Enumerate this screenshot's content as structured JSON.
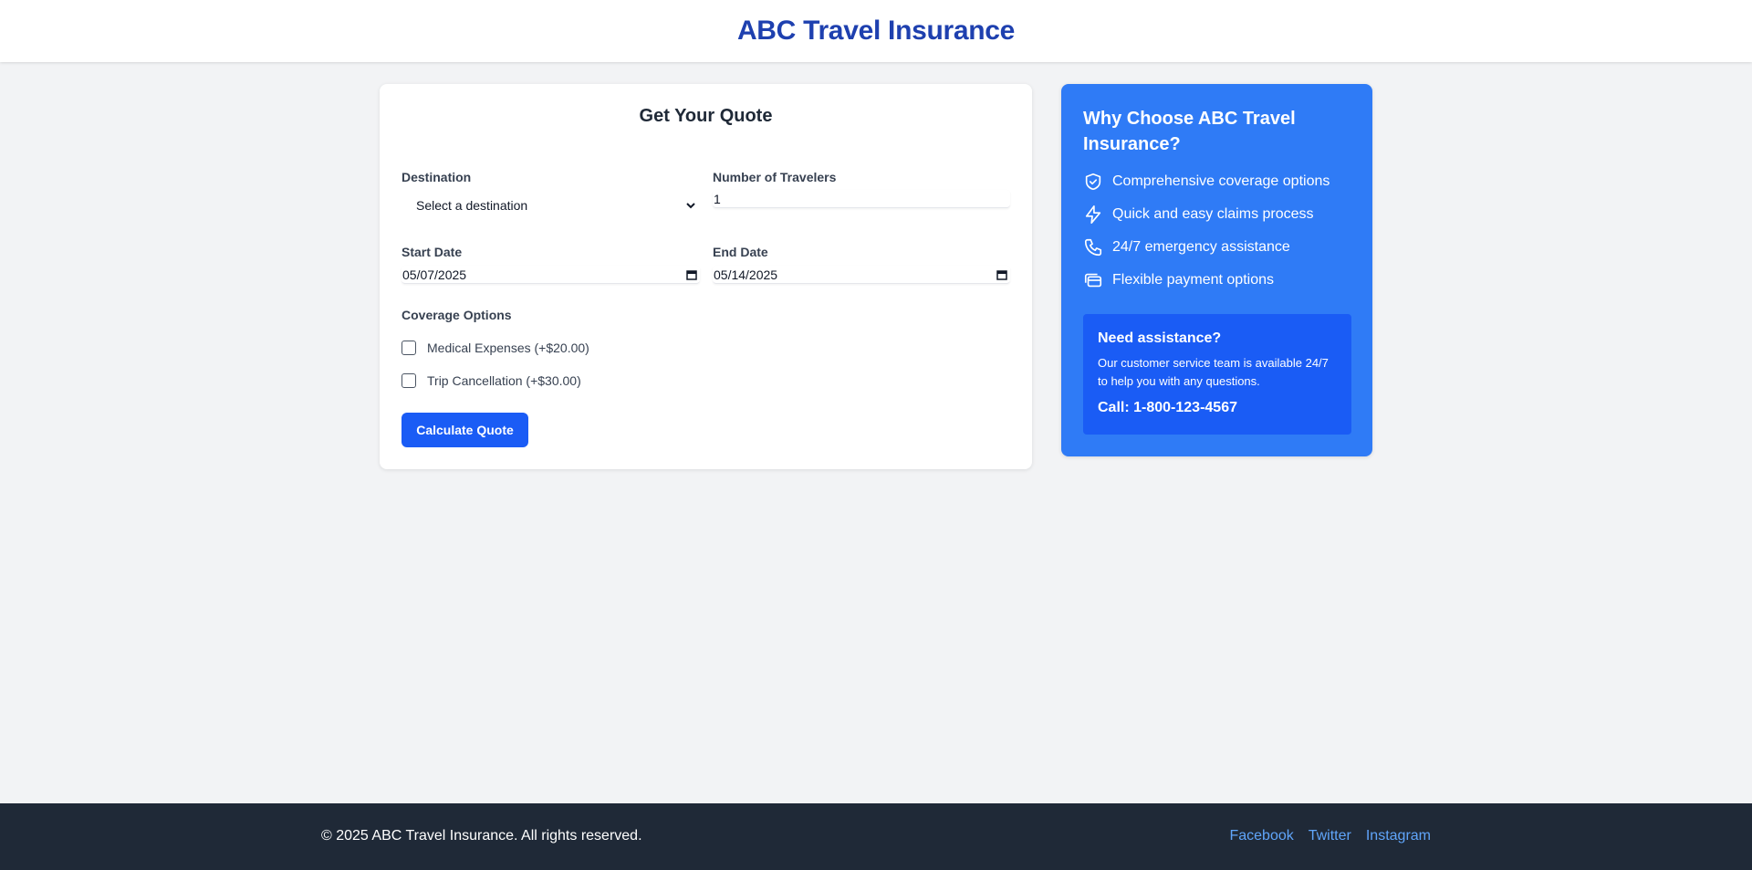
{
  "header": {
    "title": "ABC Travel Insurance"
  },
  "quote_form": {
    "title": "Get Your Quote",
    "destination_label": "Destination",
    "destination_selected": "Select a destination",
    "travelers_label": "Number of Travelers",
    "travelers_value": "1",
    "start_date_label": "Start Date",
    "start_date_value": "05/07/2025",
    "end_date_label": "End Date",
    "end_date_value": "05/14/2025",
    "coverage_label": "Coverage Options",
    "coverage_options": [
      {
        "label": "Medical Expenses (+$20.00)",
        "checked": false
      },
      {
        "label": "Trip Cancellation (+$30.00)",
        "checked": false
      }
    ],
    "calculate_label": "Calculate Quote"
  },
  "why_panel": {
    "title": "Why Choose ABC Travel Insurance?",
    "features": [
      {
        "icon": "shield-check-icon",
        "label": "Comprehensive coverage options"
      },
      {
        "icon": "lightning-icon",
        "label": "Quick and easy claims process"
      },
      {
        "icon": "phone-icon",
        "label": "24/7 emergency assistance"
      },
      {
        "icon": "credit-card-icon",
        "label": "Flexible payment options"
      }
    ],
    "assist_title": "Need assistance?",
    "assist_text": "Our customer service team is available 24/7 to help you with any questions.",
    "assist_phone": "Call: 1-800-123-4567"
  },
  "footer": {
    "copyright": "© 2025 ABC Travel Insurance. All rights reserved.",
    "links": [
      "Facebook",
      "Twitter",
      "Instagram"
    ]
  },
  "colors": {
    "brand_title": "#1e40af",
    "primary_button": "#1a5cf5",
    "panel_bg": "#2f7bf6",
    "footer_bg": "#1f2937",
    "footer_link": "#60a5fa"
  }
}
